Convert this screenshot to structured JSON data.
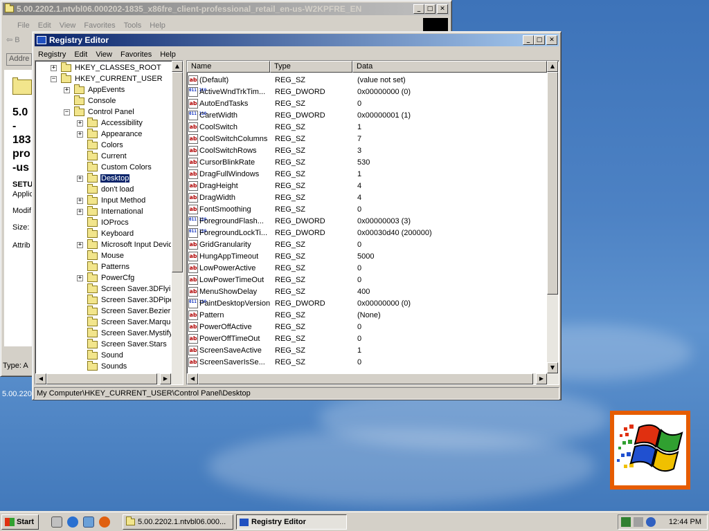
{
  "back_window": {
    "title": "5.00.2202.1.ntvbl06.000202-1835_x86fre_client-professional_retail_en-us-W2KPFRE_EN",
    "menu": [
      "File",
      "Edit",
      "View",
      "Favorites",
      "Tools",
      "Help"
    ],
    "toolbar_back": "B",
    "address_label": "Addre",
    "heading_lines": [
      "5.0",
      "-",
      "183",
      "pro",
      "-us"
    ],
    "setup_label": "SETU",
    "applic_label": "Applic",
    "modif_label": "Modif",
    "size_label": "Size:",
    "attrib_label": "Attrib",
    "status_type": "Type: A",
    "desktop_label": "5.00.220"
  },
  "regedit": {
    "title": "Registry Editor",
    "menu": [
      "Registry",
      "Edit",
      "View",
      "Favorites",
      "Help"
    ],
    "tree": [
      {
        "label": "HKEY_CLASSES_ROOT",
        "level": 0,
        "expander": "+"
      },
      {
        "label": "HKEY_CURRENT_USER",
        "level": 0,
        "expander": "-"
      },
      {
        "label": "AppEvents",
        "level": 1,
        "expander": "+"
      },
      {
        "label": "Console",
        "level": 1,
        "expander": ""
      },
      {
        "label": "Control Panel",
        "level": 1,
        "expander": "-"
      },
      {
        "label": "Accessibility",
        "level": 2,
        "expander": "+"
      },
      {
        "label": "Appearance",
        "level": 2,
        "expander": "+"
      },
      {
        "label": "Colors",
        "level": 2,
        "expander": ""
      },
      {
        "label": "Current",
        "level": 2,
        "expander": ""
      },
      {
        "label": "Custom Colors",
        "level": 2,
        "expander": ""
      },
      {
        "label": "Desktop",
        "level": 2,
        "expander": "+",
        "selected": true
      },
      {
        "label": "don't load",
        "level": 2,
        "expander": ""
      },
      {
        "label": "Input Method",
        "level": 2,
        "expander": "+"
      },
      {
        "label": "International",
        "level": 2,
        "expander": "+"
      },
      {
        "label": "IOProcs",
        "level": 2,
        "expander": ""
      },
      {
        "label": "Keyboard",
        "level": 2,
        "expander": ""
      },
      {
        "label": "Microsoft Input Devic",
        "level": 2,
        "expander": "+"
      },
      {
        "label": "Mouse",
        "level": 2,
        "expander": ""
      },
      {
        "label": "Patterns",
        "level": 2,
        "expander": ""
      },
      {
        "label": "PowerCfg",
        "level": 2,
        "expander": "+"
      },
      {
        "label": "Screen Saver.3DFlyir",
        "level": 2,
        "expander": ""
      },
      {
        "label": "Screen Saver.3DPipe",
        "level": 2,
        "expander": ""
      },
      {
        "label": "Screen Saver.Bezier",
        "level": 2,
        "expander": ""
      },
      {
        "label": "Screen Saver.Marque",
        "level": 2,
        "expander": ""
      },
      {
        "label": "Screen Saver.Mystify",
        "level": 2,
        "expander": ""
      },
      {
        "label": "Screen Saver.Stars",
        "level": 2,
        "expander": ""
      },
      {
        "label": "Sound",
        "level": 2,
        "expander": ""
      },
      {
        "label": "Sounds",
        "level": 2,
        "expander": ""
      }
    ],
    "columns": [
      "Name",
      "Type",
      "Data"
    ],
    "values": [
      {
        "name": "(Default)",
        "type": "REG_SZ",
        "data": "(value not set)"
      },
      {
        "name": "ActiveWndTrkTim...",
        "type": "REG_DWORD",
        "data": "0x00000000 (0)"
      },
      {
        "name": "AutoEndTasks",
        "type": "REG_SZ",
        "data": "0"
      },
      {
        "name": "CaretWidth",
        "type": "REG_DWORD",
        "data": "0x00000001 (1)"
      },
      {
        "name": "CoolSwitch",
        "type": "REG_SZ",
        "data": "1"
      },
      {
        "name": "CoolSwitchColumns",
        "type": "REG_SZ",
        "data": "7"
      },
      {
        "name": "CoolSwitchRows",
        "type": "REG_SZ",
        "data": "3"
      },
      {
        "name": "CursorBlinkRate",
        "type": "REG_SZ",
        "data": "530"
      },
      {
        "name": "DragFullWindows",
        "type": "REG_SZ",
        "data": "1"
      },
      {
        "name": "DragHeight",
        "type": "REG_SZ",
        "data": "4"
      },
      {
        "name": "DragWidth",
        "type": "REG_SZ",
        "data": "4"
      },
      {
        "name": "FontSmoothing",
        "type": "REG_SZ",
        "data": "0"
      },
      {
        "name": "ForegroundFlash...",
        "type": "REG_DWORD",
        "data": "0x00000003 (3)"
      },
      {
        "name": "ForegroundLockTi...",
        "type": "REG_DWORD",
        "data": "0x00030d40 (200000)"
      },
      {
        "name": "GridGranularity",
        "type": "REG_SZ",
        "data": "0"
      },
      {
        "name": "HungAppTimeout",
        "type": "REG_SZ",
        "data": "5000"
      },
      {
        "name": "LowPowerActive",
        "type": "REG_SZ",
        "data": "0"
      },
      {
        "name": "LowPowerTimeOut",
        "type": "REG_SZ",
        "data": "0"
      },
      {
        "name": "MenuShowDelay",
        "type": "REG_SZ",
        "data": "400"
      },
      {
        "name": "PaintDesktopVersion",
        "type": "REG_DWORD",
        "data": "0x00000000 (0)"
      },
      {
        "name": "Pattern",
        "type": "REG_SZ",
        "data": "(None)"
      },
      {
        "name": "PowerOffActive",
        "type": "REG_SZ",
        "data": "0"
      },
      {
        "name": "PowerOffTimeOut",
        "type": "REG_SZ",
        "data": "0"
      },
      {
        "name": "ScreenSaveActive",
        "type": "REG_SZ",
        "data": "1"
      },
      {
        "name": "ScreenSaverIsSe...",
        "type": "REG_SZ",
        "data": "0"
      }
    ],
    "status_path": "My Computer\\HKEY_CURRENT_USER\\Control Panel\\Desktop"
  },
  "taskbar": {
    "start_label": "Start",
    "tasks": [
      {
        "label": "5.00.2202.1.ntvbl06.000...",
        "active": false
      },
      {
        "label": "Registry Editor",
        "active": true
      }
    ],
    "clock": "12:44 PM"
  }
}
